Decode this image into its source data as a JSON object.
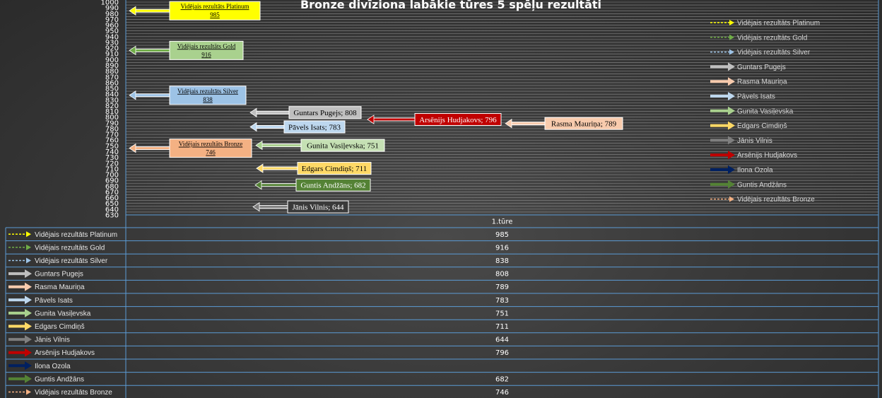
{
  "chart_data": {
    "type": "bar",
    "title": "Bronze divīziona labākie tūres 5 spēļu rezultāti",
    "categories": [
      "1.tūre"
    ],
    "ylim": [
      630,
      1000
    ],
    "ytick_step": 5,
    "ytick_label_step": 10,
    "grid": true,
    "legend_position": "right",
    "series": [
      {
        "name": "Vidējais rezultāts Platinum",
        "value": 985,
        "label": "Vidējais rezultāts Platinum 985",
        "color": "#ffff00",
        "style": "dashed",
        "kind": "average"
      },
      {
        "name": "Vidējais rezultāts Gold",
        "value": 916,
        "label": "Vidējais rezultāts Gold 916",
        "color": "#70ad47",
        "style": "dashed",
        "kind": "average",
        "box_color": "#a9d18e"
      },
      {
        "name": "Vidējais rezultāts Silver",
        "value": 838,
        "label": "Vidējais rezultāts Silver 838",
        "color": "#9dc3e6",
        "style": "dashed",
        "kind": "average"
      },
      {
        "name": "Guntars Pugejs",
        "value": 808,
        "label": "Guntars Pugejs; 808",
        "color": "#bfbfbf",
        "style": "solid"
      },
      {
        "name": "Rasma Mauriņa",
        "value": 789,
        "label": "Rasma Mauriņa; 789",
        "color": "#f8cbad",
        "style": "solid"
      },
      {
        "name": "Pāvels Isats",
        "value": 783,
        "label": "Pāvels Isats; 783",
        "color": "#bdd7ee",
        "style": "solid"
      },
      {
        "name": "Gunita Vasiļevska",
        "value": 751,
        "label": "Gunita Vasiļevska; 751",
        "color": "#a9d18e",
        "style": "solid",
        "box_color": "#c5e0b4"
      },
      {
        "name": "Edgars Cimdiņš",
        "value": 711,
        "label": "Edgars Cimdiņš; 711",
        "color": "#ffd966",
        "style": "solid"
      },
      {
        "name": "Jānis Vilnis",
        "value": 644,
        "label": "Jānis Vilnis; 644",
        "color": "#7f7f7f",
        "style": "solid",
        "box_color": "#ffffff"
      },
      {
        "name": "Arsēnijs Hudjakovs",
        "value": 796,
        "label": "Arsēnijs Hudjakovs; 796",
        "color": "#c00000",
        "style": "solid"
      },
      {
        "name": "Ilona Ozola",
        "value": null,
        "label": "",
        "color": "#002060",
        "style": "solid"
      },
      {
        "name": "Guntis Andžāns",
        "value": 682,
        "label": "Guntis Andžāns; 682",
        "color": "#548235",
        "style": "solid"
      },
      {
        "name": "Vidējais rezultāts Bronze",
        "value": 746,
        "label": "Vidējais rezultāts Bronze 746",
        "color": "#f4b183",
        "style": "dashed",
        "kind": "average"
      }
    ]
  }
}
